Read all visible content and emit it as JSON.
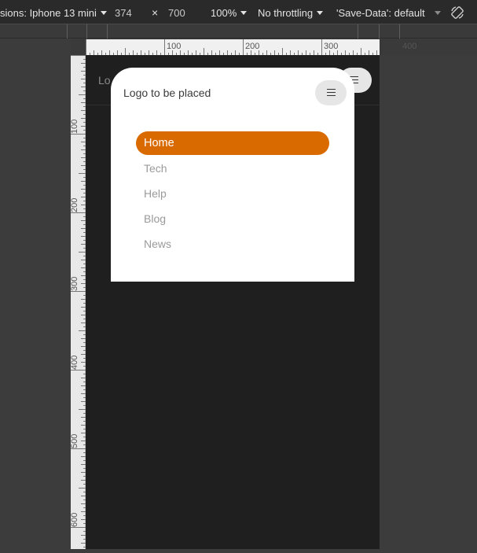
{
  "toolbar": {
    "device_label": "sions: Iphone 13 mini",
    "width": "374",
    "times": "×",
    "height": "700",
    "zoom": "100%",
    "throttling": "No throttling",
    "save_data": "'Save-Data': default"
  },
  "ruler_h": {
    "labels": [
      "100",
      "200",
      "300",
      "400"
    ]
  },
  "ruler_v": {
    "labels": [
      "100",
      "200",
      "300",
      "400",
      "500",
      "600"
    ]
  },
  "page": {
    "logo_text": "Lo"
  },
  "menu": {
    "logo_text": "Logo to be placed",
    "items": [
      {
        "label": "Home",
        "active": true
      },
      {
        "label": "Tech",
        "active": false
      },
      {
        "label": "Help",
        "active": false
      },
      {
        "label": "Blog",
        "active": false
      },
      {
        "label": "News",
        "active": false
      }
    ],
    "accent_color": "#d96a00"
  }
}
